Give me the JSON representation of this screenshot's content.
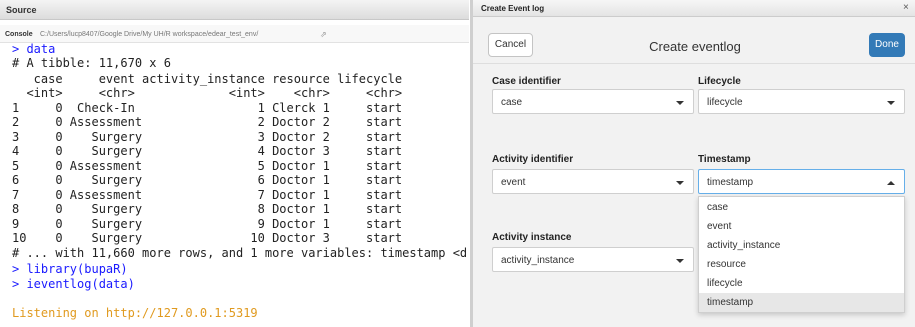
{
  "left_pane": {
    "source_title": "Source",
    "console_title": "Console",
    "console_path": "C:/Users/lucp8407/Google Drive/My UH/R workspace/edear_test_env/",
    "console_lines": [
      {
        "text": "> data",
        "color": "blue"
      },
      {
        "text": "# A tibble: 11,670 x 6",
        "color": "black"
      },
      {
        "text": "   case     event activity_instance resource lifecycle",
        "color": "black"
      },
      {
        "text": "  <int>     <chr>             <int>    <chr>     <chr>",
        "color": "black"
      },
      {
        "text": "1     0  Check-In                 1 Clerck 1     start",
        "color": "black"
      },
      {
        "text": "2     0 Assessment                2 Doctor 2     start",
        "color": "black"
      },
      {
        "text": "3     0    Surgery                3 Doctor 2     start",
        "color": "black"
      },
      {
        "text": "4     0    Surgery                4 Doctor 3     start",
        "color": "black"
      },
      {
        "text": "5     0 Assessment                5 Doctor 1     start",
        "color": "black"
      },
      {
        "text": "6     0    Surgery                6 Doctor 1     start",
        "color": "black"
      },
      {
        "text": "7     0 Assessment                7 Doctor 1     start",
        "color": "black"
      },
      {
        "text": "8     0    Surgery                8 Doctor 1     start",
        "color": "black"
      },
      {
        "text": "9     0    Surgery                9 Doctor 1     start",
        "color": "black"
      },
      {
        "text": "10    0    Surgery               10 Doctor 3     start",
        "color": "black"
      },
      {
        "text": "# ... with 11,660 more rows, and 1 more variables: timestamp <d",
        "color": "black"
      },
      {
        "text": "> library(bupaR)",
        "color": "blue"
      },
      {
        "text": "> ieventlog(data)",
        "color": "blue"
      },
      {
        "text": "",
        "color": "black"
      },
      {
        "text": "Listening on http://127.0.0.1:5319",
        "color": "orange"
      }
    ]
  },
  "modal": {
    "window_title": "Create Event log",
    "close_glyph": "×",
    "cancel_label": "Cancel",
    "header_title": "Create eventlog",
    "done_label": "Done",
    "fields": {
      "case_identifier": {
        "label": "Case identifier",
        "value": "case"
      },
      "lifecycle": {
        "label": "Lifecycle",
        "value": "lifecycle"
      },
      "activity_identifier": {
        "label": "Activity identifier",
        "value": "event"
      },
      "timestamp": {
        "label": "Timestamp",
        "value": "timestamp"
      },
      "activity_instance": {
        "label": "Activity instance",
        "value": "activity_instance"
      }
    },
    "timestamp_options": [
      "case",
      "event",
      "activity_instance",
      "resource",
      "lifecycle",
      "timestamp"
    ],
    "timestamp_active_option": "timestamp"
  },
  "colors": {
    "console_blue": "#1a1aff",
    "console_orange": "#e09a1f",
    "done_button": "#337ab7"
  },
  "icons": {
    "console_path_icon": "arrow-icon",
    "close": "close-icon",
    "select_caret": "chevron-down-icon"
  }
}
